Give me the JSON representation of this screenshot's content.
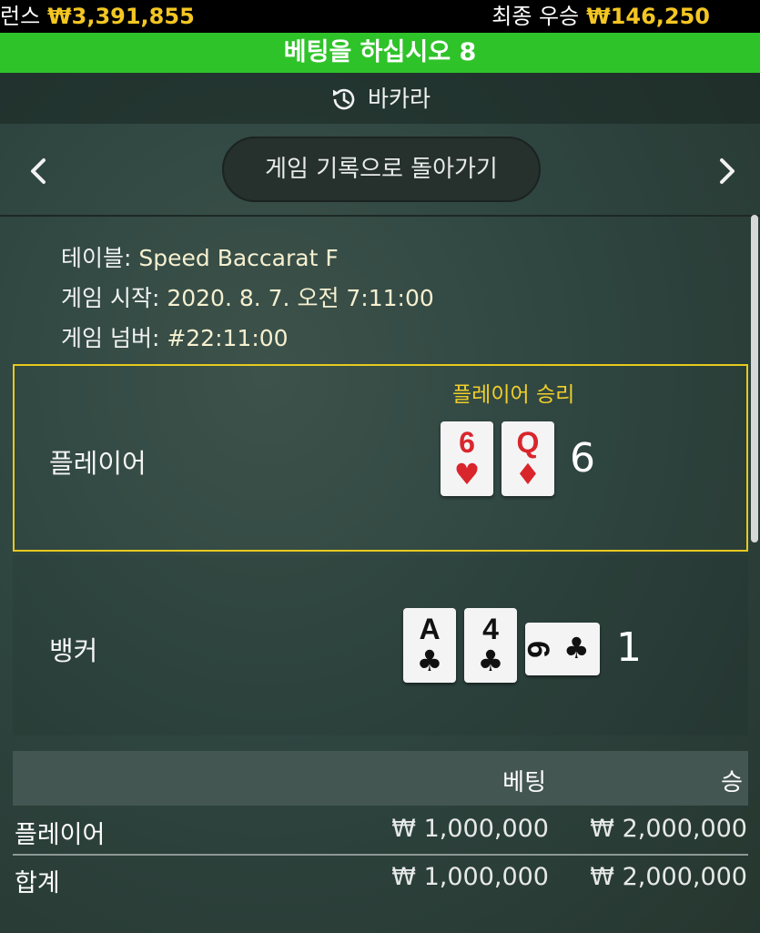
{
  "topbar": {
    "balance_label": "런스",
    "balance_value": "₩3,391,855",
    "last_win_label": "최종 우승",
    "last_win_value": "₩146,250"
  },
  "banner": {
    "text": "베팅을 하십시오 8"
  },
  "header": {
    "title": "바카라",
    "history_icon": "history-icon"
  },
  "nav": {
    "back_button": "게임 기록으로 돌아가기",
    "prev_icon": "chevron-left-icon",
    "next_icon": "chevron-right-icon"
  },
  "info": {
    "table_label": "테이블: ",
    "table_value": "Speed Baccarat F",
    "start_label": "게임 시작: ",
    "start_value": "2020. 8. 7. 오전 7:11:00",
    "number_label": "게임 넘버: ",
    "number_value": "#22:11:00"
  },
  "player": {
    "label": "플레이어",
    "result": "플레이어 승리",
    "score": "6",
    "cards": [
      {
        "rank": "6",
        "suit": "♥"
      },
      {
        "rank": "Q",
        "suit": "♦"
      }
    ]
  },
  "banker": {
    "label": "뱅커",
    "score": "1",
    "cards": [
      {
        "rank": "A",
        "suit": "♣"
      },
      {
        "rank": "4",
        "suit": "♣"
      },
      {
        "rank": "6",
        "suit": "♣"
      }
    ]
  },
  "table": {
    "col_bet": "베팅",
    "col_win": "승",
    "rows": [
      {
        "name": "플레이어",
        "bet": "₩ 1,000,000",
        "win": "₩ 2,000,000"
      },
      {
        "name": "합계",
        "bet": "₩ 1,000,000",
        "win": "₩ 2,000,000"
      }
    ]
  },
  "colors": {
    "accent_yellow": "#f3c622",
    "banner_green": "#2fc32a",
    "win_border": "#e7c91d"
  }
}
